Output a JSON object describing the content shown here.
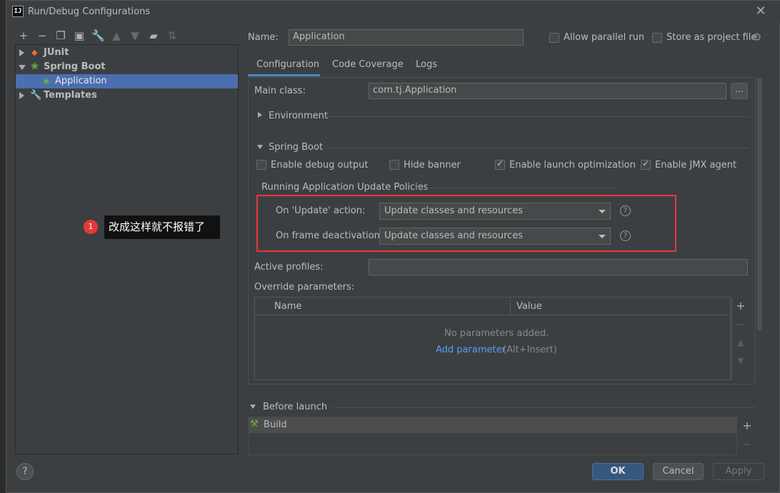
{
  "window": {
    "title": "Run/Debug Configurations",
    "icon_text": "IJ"
  },
  "toolbar": {
    "icons": [
      "add-icon",
      "remove-icon",
      "copy-icon",
      "save-icon",
      "wrench-icon",
      "move-up-icon",
      "move-down-icon",
      "folder-icon",
      "sort-icon"
    ]
  },
  "tree": {
    "items": [
      {
        "label": "JUnit"
      },
      {
        "label": "Spring Boot"
      },
      {
        "label": "Application"
      },
      {
        "label": "Templates"
      }
    ]
  },
  "annotation": {
    "badge": "1",
    "text": "改成这样就不报错了"
  },
  "header": {
    "name_label": "Name:",
    "name_value": "Application",
    "allow_parallel": "Allow parallel run",
    "store_as_project": "Store as project file"
  },
  "tabs": [
    "Configuration",
    "Code Coverage",
    "Logs"
  ],
  "config": {
    "main_class_label": "Main class:",
    "main_class_value": "com.tj.Application",
    "browse_label": "...",
    "environment": "Environment",
    "spring_boot": "Spring Boot",
    "enable_debug": "Enable debug output",
    "hide_banner": "Hide banner",
    "enable_launch_opt": "Enable launch optimization",
    "enable_jmx": "Enable JMX agent",
    "policies_title": "Running Application Update Policies",
    "on_update_label": "On 'Update' action:",
    "on_update_value": "Update classes and resources",
    "on_frame_label": "On frame deactivation:",
    "on_frame_value": "Update classes and resources",
    "active_profiles_label": "Active profiles:",
    "override_label": "Override parameters:",
    "col_name": "Name",
    "col_value": "Value",
    "no_params": "No parameters added.",
    "add_param": "Add parameter",
    "add_param_hint": "(Alt+Insert)"
  },
  "before_launch": {
    "title": "Before launch",
    "item": "Build"
  },
  "buttons": {
    "help": "?",
    "ok": "OK",
    "cancel": "Cancel",
    "apply": "Apply"
  },
  "colors": {
    "selection": "#4b6eaf",
    "highlight_box": "#e5393a",
    "link": "#589df6",
    "primary_button": "#365880"
  }
}
